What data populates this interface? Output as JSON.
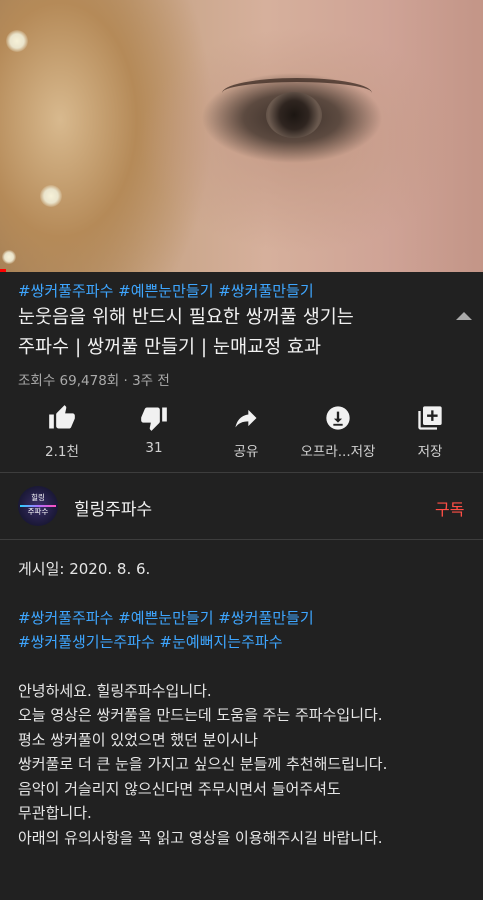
{
  "video": {
    "progress_percent": 1
  },
  "hashtags_top": "#쌍커풀주파수 #예쁜눈만들기 #쌍커풀만들기",
  "title_lines": [
    "눈웃음을 위해 반드시 필요한 쌍꺼풀 생기는",
    "주파수 | 쌍꺼풀 만들기 | 눈매교정 효과"
  ],
  "meta": "조회수 69,478회 · 3주 전",
  "actions": {
    "like": "2.1천",
    "dislike": "31",
    "share": "공유",
    "offline": "오프라...저장",
    "save": "저장"
  },
  "channel": {
    "avatar_line1": "힐링",
    "avatar_line2": "주파수",
    "name": "힐링주파수",
    "subscribe": "구독"
  },
  "description": {
    "posted": "게시일: 2020. 8. 6.",
    "tags_line1": "#쌍커풀주파수 #예쁜눈만들기 #쌍커풀만들기",
    "tags_line2": "#쌍커풀생기는주파수 #눈예뻐지는주파수",
    "lines": [
      "안녕하세요. 힐링주파수입니다.",
      "오늘 영상은 쌍커풀을 만드는데 도움을 주는 주파수입니다.",
      "평소 쌍커풀이 있었으면 했던 분이시나",
      "쌍커풀로 더 큰 눈을 가지고 싶으신 분들께 추천해드립니다.",
      "음악이 거슬리지 않으신다면 주무시면서 들어주셔도",
      "무관합니다.",
      "아래의 유의사항을 꼭 읽고 영상을 이용해주시길 바랍니다."
    ]
  },
  "colors": {
    "background": "#212121",
    "link": "#3ea6ff",
    "subscribe": "#ff4e45",
    "progress": "#ff0000"
  },
  "icons": [
    "like-icon",
    "dislike-icon",
    "share-icon",
    "download-icon",
    "playlist-add-icon",
    "expand-less-icon"
  ]
}
